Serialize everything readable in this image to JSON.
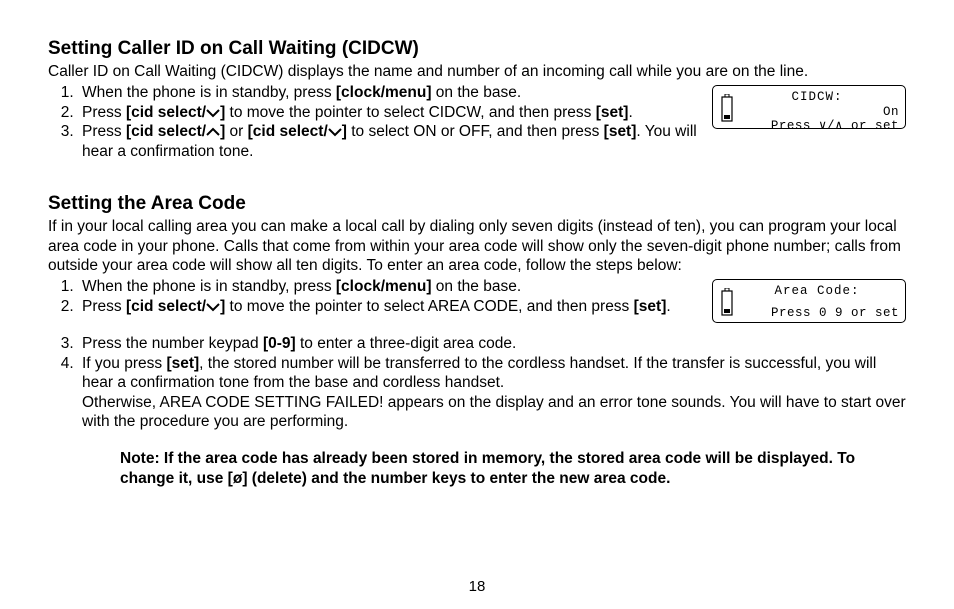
{
  "page_number": "18",
  "section_cidcw": {
    "heading": "Setting Caller ID on Call Waiting (CIDCW)",
    "lead": "Caller ID on Call Waiting (CIDCW) displays the name and number of an incoming call while you are on the line.",
    "step1_a": "When the phone is in standby, press ",
    "step1_b": "[clock/menu]",
    "step1_c": " on the base.",
    "step2_a": "Press ",
    "step2_b": "[cid select/",
    "step2_c": "]",
    "step2_d": " to move the pointer to select CIDCW, and then press ",
    "step2_e": "[set]",
    "step2_f": ".",
    "step3_a": "Press ",
    "step3_b": "[cid select/",
    "step3_c": "]",
    "step3_d": " or ",
    "step3_e": "[cid select/",
    "step3_f": "]",
    "step3_g": " to select ON or OFF, and then press ",
    "step3_h": "[set]",
    "step3_i": ". You will hear a confirmation tone.",
    "lcd_line1": "CIDCW:",
    "lcd_line2a": "On",
    "lcd_line2b": "Press ∨/∧ or set"
  },
  "section_area": {
    "heading": "Setting the Area Code",
    "lead": "If in your local calling area you can make a local call by dialing only seven digits (instead of ten), you can program your local area code in your phone. Calls that come from within your area code will show only the seven-digit phone number; calls from outside your area code will show all ten digits. To enter an area code, follow the steps below:",
    "step1_a": "When the phone is in standby, press ",
    "step1_b": "[clock/menu]",
    "step1_c": " on the base.",
    "step2_a": "Press ",
    "step2_b": "[cid select/",
    "step2_c": "]",
    "step2_d": " to move the pointer to select AREA CODE, and then press ",
    "step2_e": "[set]",
    "step2_f": ".",
    "step3_a": "Press the number keypad ",
    "step3_b": "[0-9]",
    "step3_c": " to enter a three-digit area code.",
    "step4_a": "If you press ",
    "step4_b": "[set]",
    "step4_c": ", the stored number will be transferred to the cordless handset. If the transfer is successful, you will hear a confirmation tone from the base and cordless handset.",
    "step4_d": "Otherwise, AREA CODE SETTING FAILED! appears on the display and an error tone sounds. You will have to start over with the procedure you are performing.",
    "note_a": "Note: If the area code has already been stored in memory, the stored area code will be displayed. To change it, use [",
    "note_b": "ø",
    "note_c": "] (delete) and the number keys to enter the new area code.",
    "lcd_line1": "Area Code:",
    "lcd_line2": "Press 0 9 or set"
  }
}
